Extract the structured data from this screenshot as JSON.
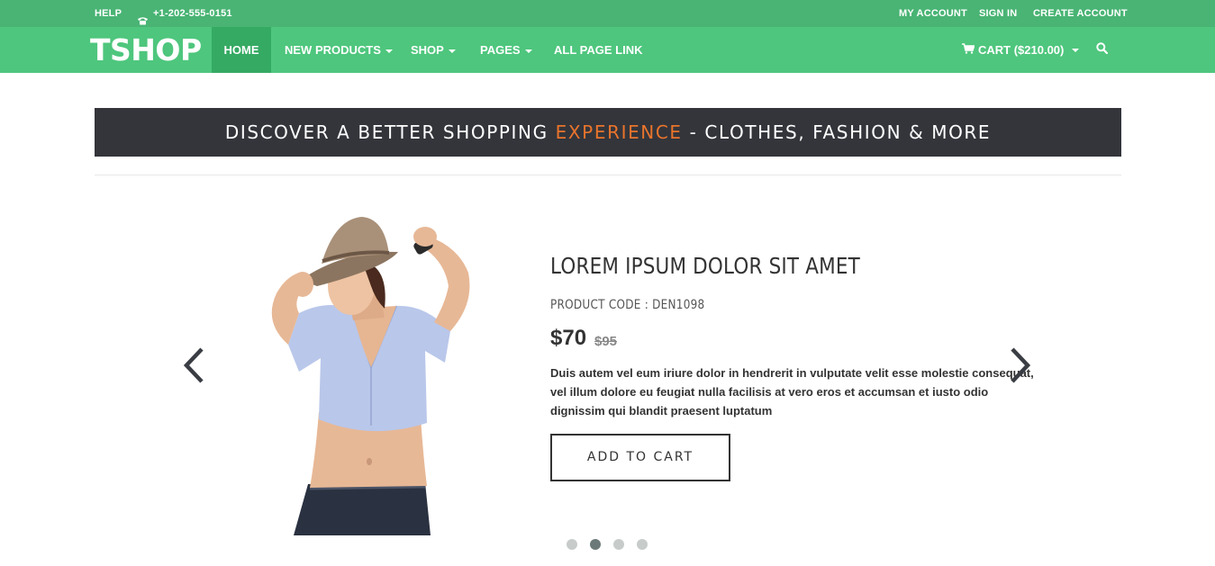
{
  "topbar": {
    "help": "HELP",
    "phone": "+1-202-555-0151",
    "my_account": "MY ACCOUNT",
    "sign_in": "SIGN IN",
    "create_account": "CREATE ACCOUNT"
  },
  "nav": {
    "logo": "TSHOP",
    "items": [
      {
        "label": "HOME"
      },
      {
        "label": "NEW PRODUCTS"
      },
      {
        "label": "SHOP"
      },
      {
        "label": "PAGES"
      },
      {
        "label": "ALL PAGE LINK"
      }
    ],
    "cart": "CART ($210.00)"
  },
  "banner": {
    "before": "DISCOVER A BETTER SHOPPING ",
    "accent": "EXPERIENCE",
    "after": " - CLOTHES, FASHION & MORE"
  },
  "slide": {
    "title": "LOREM IPSUM DOLOR SIT AMET",
    "product_code": "PRODUCT CODE : DEN1098",
    "price": "$70",
    "old_price": "$95",
    "description_lines": [
      "Duis autem vel eum iriure dolor in hendrerit in vulputate velit esse molestie consequat,",
      "vel illum dolore eu feugiat nulla facilisis at vero eros et accumsan et iusto odio",
      "dignissim qui blandit praesent luptatum"
    ],
    "button": "ADD TO CART"
  },
  "slider": {
    "dot_count": 4,
    "active_index": 1
  },
  "colors": {
    "topbar": "#49b474",
    "navbar": "#4ec67d",
    "nav_active": "#35aa63",
    "banner_bg": "#33353b",
    "banner_accent": "#e9742c"
  },
  "icons": {
    "phone": "phone-icon",
    "cart": "cart-icon",
    "search": "search-icon",
    "prev": "chevron-left-icon",
    "next": "chevron-right-icon"
  }
}
